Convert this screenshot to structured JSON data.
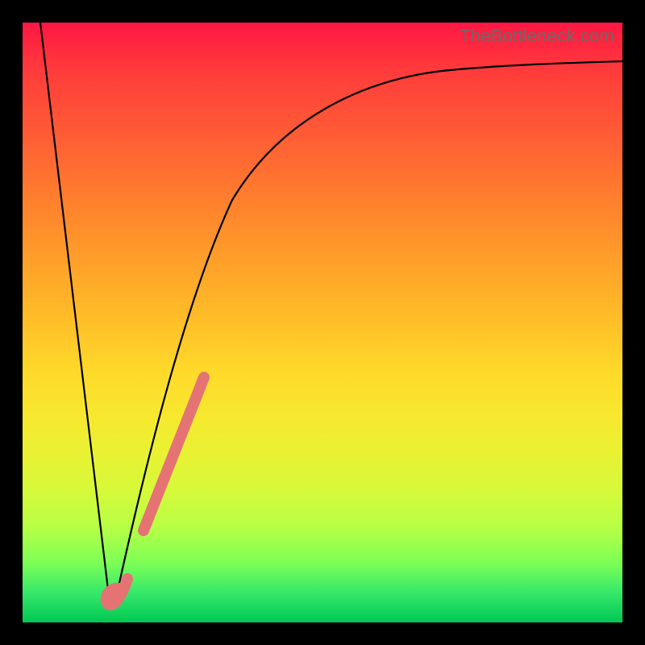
{
  "watermark": "TheBottleneck.com",
  "chart_data": {
    "type": "line",
    "title": "",
    "xlabel": "",
    "ylabel": "",
    "xlim": [
      0,
      100
    ],
    "ylim": [
      0,
      100
    ],
    "background_gradient": {
      "top": "#ff1744",
      "bottom": "#00c853"
    },
    "series": [
      {
        "name": "bottleneck-curve",
        "description": "V-shaped curve: steep linear descent from top-left to a minimum near x≈14, then asymptotic rise toward the right edge.",
        "x": [
          3,
          6,
          9,
          12,
          14,
          16,
          18,
          20,
          22,
          25,
          28,
          32,
          36,
          40,
          45,
          50,
          55,
          60,
          65,
          70,
          75,
          80,
          85,
          90,
          95,
          100
        ],
        "y": [
          100,
          78,
          55,
          33,
          3,
          10,
          20,
          30,
          38,
          48,
          56,
          64,
          70,
          74,
          78,
          81,
          83.5,
          85.5,
          87,
          88,
          89,
          89.8,
          90.5,
          91,
          91.4,
          91.7
        ]
      }
    ],
    "highlights": [
      {
        "name": "highlight-segment",
        "color": "#e57373",
        "approx_x_range": [
          20,
          30
        ],
        "approx_y_range": [
          30,
          58
        ]
      },
      {
        "name": "minimum-hook",
        "color": "#e57373",
        "approx_x": 15,
        "approx_y": 3
      }
    ]
  }
}
